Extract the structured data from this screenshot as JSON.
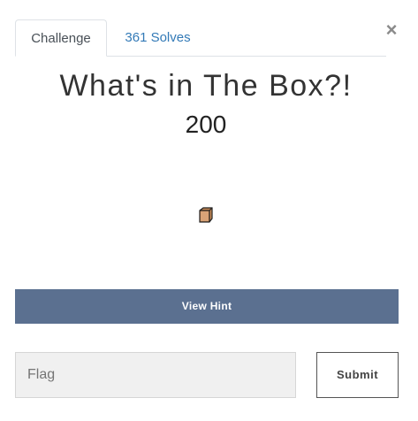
{
  "tabs": [
    {
      "label": "Challenge"
    },
    {
      "label": "361 Solves"
    }
  ],
  "close_icon": "×",
  "challenge": {
    "title": "What's in The Box?!",
    "points": "200",
    "attachment_icon": "box-icon"
  },
  "hint_button": {
    "label": "View Hint"
  },
  "flag": {
    "placeholder": "Flag",
    "value": ""
  },
  "submit_button": {
    "label": "Submit"
  },
  "colors": {
    "hint_bg": "#5b7090",
    "tab_link": "#337ab7",
    "input_bg": "#f0f0f0"
  }
}
